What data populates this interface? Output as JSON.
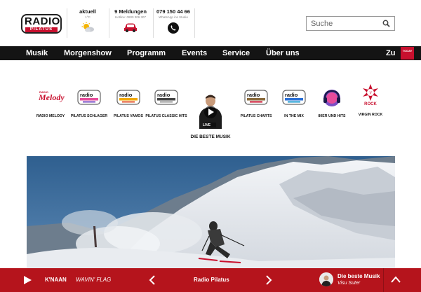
{
  "header": {
    "logo_top": "RADIO",
    "logo_bottom": "PILATUS",
    "weather": {
      "label": "aktuell",
      "temp": "1°C",
      "icon": "sun-cloud-icon"
    },
    "traffic": {
      "label": "9 Meldungen",
      "sub": "Hotline: 0800 306 307",
      "icon": "car-icon"
    },
    "whatsapp": {
      "label": "079 150 44 66",
      "sub": "WhatsApp ins Studio",
      "icon": "whatsapp-icon"
    },
    "search": {
      "placeholder": "Suche",
      "icon": "search-icon"
    }
  },
  "nav": {
    "items": [
      "Musik",
      "Morgenshow",
      "Programm",
      "Events",
      "Service",
      "Über uns"
    ],
    "zu": "Zu",
    "today_badge": "TODAY"
  },
  "stations": [
    {
      "name": "RADIO MELODY",
      "logo": "Melody"
    },
    {
      "name": "PILATUS SCHLAGER",
      "logo": "RADIO PILATUS"
    },
    {
      "name": "PILATUS VAMOS",
      "logo": "RADIO PILATUS"
    },
    {
      "name": "PILATUS CLASSIC HITS",
      "logo": "RADIO PILATUS"
    },
    {
      "name": "DIE BESTE MUSIK",
      "live": "LIVE"
    },
    {
      "name": "PILATUS CHARTS",
      "logo": "RADIO PILATUS"
    },
    {
      "name": "IN THE MIX",
      "logo": "RADIO PILATUS"
    },
    {
      "name": "80ER UND HITS",
      "logo": "headphones"
    },
    {
      "name": "VIRGIN ROCK",
      "logo": "Virgin"
    }
  ],
  "player": {
    "artist": "K'NAAN",
    "title": "WAVIN' FLAG",
    "station": "Radio Pilatus",
    "show": "Die beste Musik",
    "host": "Visu Suter"
  },
  "colors": {
    "brand_red": "#c8102e",
    "player_red": "#b5141c",
    "nav_bg": "#141414"
  }
}
